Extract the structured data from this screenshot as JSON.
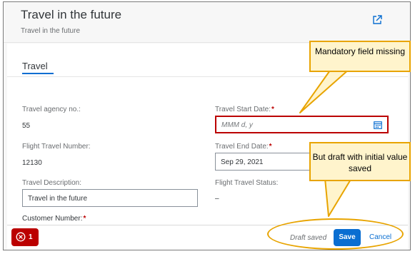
{
  "header": {
    "title": "Travel in the future",
    "subtitle": "Travel in the future",
    "share_icon": "share-icon"
  },
  "section": {
    "title": "Travel"
  },
  "fields": {
    "agency_label": "Travel agency no.:",
    "agency_value": "55",
    "flight_number_label": "Flight Travel Number:",
    "flight_number_value": "12130",
    "description_label": "Travel Description:",
    "description_value": "Travel in the future",
    "customer_label": "Customer Number:",
    "customer_required": "*",
    "start_date_label": "Travel Start Date:",
    "start_date_required": "*",
    "start_date_placeholder": "MMM d, y",
    "end_date_label": "Travel End Date:",
    "end_date_required": "*",
    "end_date_value": "Sep 29, 2021",
    "status_label": "Flight Travel Status:",
    "status_value": "–"
  },
  "footer": {
    "error_count": "1",
    "draft_status": "Draft saved",
    "save_label": "Save",
    "cancel_label": "Cancel"
  },
  "annotations": {
    "callout_top": "Mandatory field missing",
    "callout_bottom": "But draft with initial value saved"
  },
  "colors": {
    "accent": "#0a6ed1",
    "error": "#bb0000",
    "callout_fill": "#fff4cc",
    "callout_border": "#e8a400"
  }
}
